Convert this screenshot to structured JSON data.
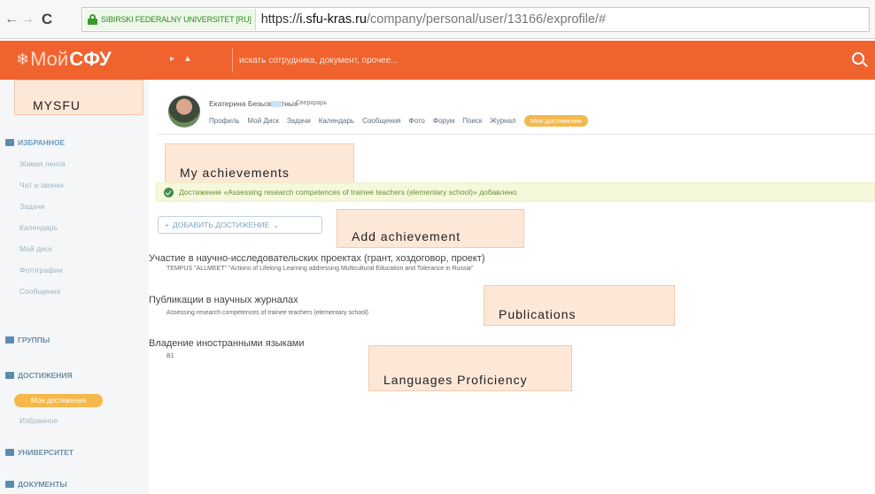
{
  "browser": {
    "ssl_label": "SIBIRSKI FEDERALNY UNIVERSITET [RU]",
    "url_scheme": "https://",
    "url_host": "i.sfu-kras.ru",
    "url_path": "/company/personal/user/13166/exprofile/#"
  },
  "header": {
    "logo_prefix": "Мой",
    "logo_brand": "СФУ",
    "search_placeholder": "искать сотрудника, документ, прочее...",
    "accent_color": "#f0622e"
  },
  "sidebar": {
    "redacted_label": "MYSFU",
    "favorites_title": "ИЗБРАННОЕ",
    "favorites_items": [
      "Живая лента",
      "Чат и звонки",
      "Задачи",
      "Календарь",
      "Мой диск",
      "Фотографии",
      "Сообщения"
    ],
    "groups_title": "ГРУППЫ",
    "achievements_title": "ДОСТИЖЕНИЯ",
    "achievements_active": "Мои достижения",
    "achievements_item": "Избранное",
    "university_title": "УНИВЕРСИТЕТ",
    "documents_title": "ДОКУМЕНТЫ"
  },
  "profile": {
    "name": "Екатерина Безызвестных",
    "role": "Сверхрарь",
    "tabs": [
      "Профиль",
      "Мой Диск",
      "Задачи",
      "Календарь",
      "Сообщения",
      "Фото",
      "Форум",
      "Поиск",
      "Журнал"
    ],
    "active_tab": "Мои достижения"
  },
  "main": {
    "redact_title": "My achievements",
    "alert_text": "Достижение «Assessing research competences of trainee teachers (elementary school)» добавлено",
    "add_button": "ДОБАВИТЬ ДОСТИЖЕНИЕ",
    "redact_add": "Add achievement",
    "sections": [
      {
        "title": "Участие в научно-исследовательских проектах (грант, хоздоговор, проект)",
        "value": "TEMPUS \"ALLMEET\" \"Actions of Lifelong Learning addressing Multicultural Education and Tolerance in Russia\""
      },
      {
        "title": "Публикации в научных журналах",
        "value": "Assessing research competences of trainee teachers (elementary school)"
      },
      {
        "title": "Владение иностранными языками",
        "value": "B1"
      }
    ],
    "redact_pubs": "Publications",
    "redact_lang": "Languages Proficiency"
  }
}
